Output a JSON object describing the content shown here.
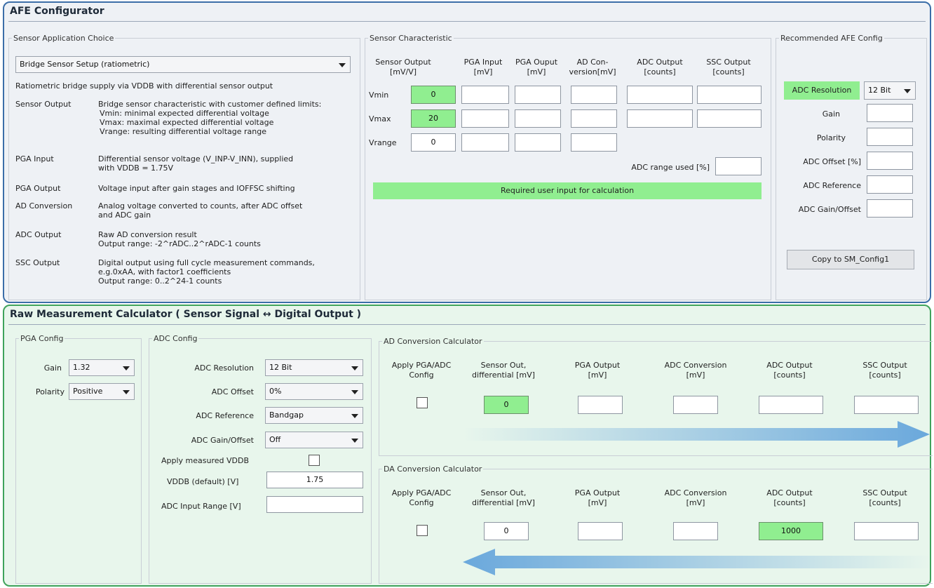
{
  "afe": {
    "title": "AFE Configurator",
    "app_choice": {
      "legend": "Sensor Application Choice",
      "selected": "Bridge Sensor Setup (ratiometric)",
      "intro": "Ratiometric bridge supply via VDDB with differential sensor output",
      "rows": [
        {
          "key": "Sensor Output",
          "lines": [
            "Bridge sensor characteristic with customer defined limits:",
            "Vmin: minimal expected differential voltage",
            "Vmax: maximal expected differential voltage",
            "Vrange: resulting differential voltage range"
          ]
        },
        {
          "key": "PGA Input",
          "lines": [
            "Differential sensor voltage (V_INP-V_INN), supplied",
            "with VDDB = 1.75V"
          ]
        },
        {
          "key": "PGA Output",
          "lines": [
            "Voltage input after gain stages and IOFFSC shifting"
          ]
        },
        {
          "key": "AD Conversion",
          "lines": [
            "Analog voltage converted to counts, after ADC offset",
            "and ADC gain"
          ]
        },
        {
          "key": "ADC Output",
          "lines": [
            "Raw AD conversion result",
            "Output range: -2^rADC..2^rADC-1 counts"
          ]
        },
        {
          "key": "SSC Output",
          "lines": [
            "Digital output using full cycle measurement commands,",
            "e.g.0xAA, with factor1 coefficients",
            "Output range: 0..2^24-1 counts"
          ]
        }
      ]
    },
    "characteristic": {
      "legend": "Sensor Characteristic",
      "headers": [
        [
          "Sensor Output",
          "[mV/V]"
        ],
        [
          "PGA Input",
          "[mV]"
        ],
        [
          "PGA Ouput",
          "[mV]"
        ],
        [
          "AD Con-",
          "version[mV]"
        ],
        [
          "ADC Output",
          "[counts]"
        ],
        [
          "SSC Output",
          "[counts]"
        ]
      ],
      "rows": [
        {
          "label": "Vmin",
          "value": "0"
        },
        {
          "label": "Vmax",
          "value": "20"
        },
        {
          "label": "Vrange",
          "value": "0"
        }
      ],
      "adc_range_label": "ADC range used [%]",
      "required_note": "Required user input for calculation"
    },
    "recommended": {
      "legend": "Recommended AFE Config",
      "adc_resolution_label": "ADC Resolution",
      "adc_resolution_value": "12 Bit",
      "fields": [
        "Gain",
        "Polarity",
        "ADC Offset [%]",
        "ADC Reference",
        "ADC Gain/Offset"
      ],
      "copy_button": "Copy to SM_Config1"
    }
  },
  "raw": {
    "title": "Raw Measurement Calculator ( Sensor Signal ↔ Digital Output )",
    "pga": {
      "legend": "PGA Config",
      "gain_label": "Gain",
      "gain_value": "1.32",
      "polarity_label": "Polarity",
      "polarity_value": "Positive"
    },
    "adc": {
      "legend": "ADC Config",
      "resolution_label": "ADC Resolution",
      "resolution_value": "12 Bit",
      "offset_label": "ADC Offset",
      "offset_value": "0%",
      "reference_label": "ADC Reference",
      "reference_value": "Bandgap",
      "gain_offset_label": "ADC Gain/Offset",
      "gain_offset_value": "Off",
      "apply_vddb_label": "Apply measured VDDB",
      "vddb_label": "VDDB (default) [V]",
      "vddb_value": "1.75",
      "input_range_label": "ADC Input Range [V]",
      "input_range_value": ""
    },
    "calc_headers": [
      [
        "Apply PGA/ADC",
        "Config"
      ],
      [
        "Sensor Out,",
        "differential [mV]"
      ],
      [
        "PGA Output",
        "[mV]"
      ],
      [
        "ADC Conversion",
        "[mV]"
      ],
      [
        "ADC Output",
        "[counts]"
      ],
      [
        "SSC Output",
        "[counts]"
      ]
    ],
    "ad_calc": {
      "legend": "AD Conversion Calculator",
      "sensor_out": "0",
      "arrow_color": "#6aa8dc"
    },
    "da_calc": {
      "legend": "DA Conversion Calculator",
      "sensor_out": "0",
      "adc_output": "1000",
      "arrow_color": "#6aa8dc"
    }
  }
}
